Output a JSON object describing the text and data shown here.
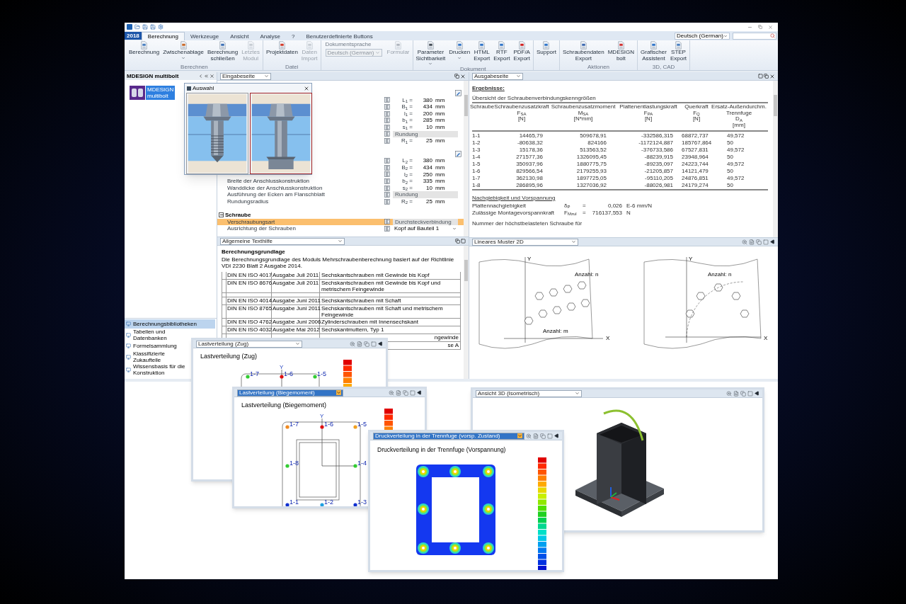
{
  "version": "2018",
  "tabs": [
    {
      "label": "Berechnung",
      "selected": true
    },
    {
      "label": "Werkzeuge",
      "selected": false
    },
    {
      "label": "Ansicht",
      "selected": false
    },
    {
      "label": "Analyse",
      "selected": false
    },
    {
      "label": "?",
      "selected": false
    },
    {
      "label": "Benutzerdefinierte Buttons",
      "selected": false
    }
  ],
  "language": "Deutsch (German)",
  "ribbon": [
    {
      "label": "Berechnen",
      "items": [
        {
          "kind": "button",
          "lines": [
            "Berechnung"
          ],
          "disabled": false,
          "dropdown": false
        },
        {
          "kind": "button",
          "lines": [
            "Zwischenablage"
          ],
          "disabled": false,
          "dropdown": true
        },
        {
          "kind": "button",
          "lines": [
            "Berechnung",
            "schließen"
          ],
          "disabled": false,
          "dropdown": false
        },
        {
          "kind": "button",
          "lines": [
            "Letztes",
            "Modul"
          ],
          "disabled": true,
          "dropdown": false
        }
      ]
    },
    {
      "label": "Datei",
      "items": [
        {
          "kind": "button",
          "lines": [
            "Projektdaten"
          ],
          "disabled": false,
          "dropdown": false
        },
        {
          "kind": "button",
          "lines": [
            "Daten",
            "Import"
          ],
          "disabled": true,
          "dropdown": false
        }
      ]
    },
    {
      "items": [
        {
          "kind": "language",
          "caption": "Dokumentsprache",
          "value": "Deutsch (German)",
          "disabled": true
        },
        {
          "kind": "button",
          "lines": [
            "Formular"
          ],
          "disabled": true,
          "dropdown": false
        }
      ]
    },
    {
      "label": "Dokument",
      "items": [
        {
          "kind": "button",
          "lines": [
            "Parameter",
            "Sichtbarkeit"
          ],
          "disabled": false,
          "dropdown": true
        },
        {
          "kind": "button",
          "lines": [
            "Drucken"
          ],
          "disabled": false,
          "dropdown": true
        },
        {
          "kind": "button",
          "lines": [
            "HTML",
            "Export"
          ],
          "disabled": false,
          "dropdown": false
        },
        {
          "kind": "button",
          "lines": [
            "RTF",
            "Export"
          ],
          "disabled": false,
          "dropdown": false
        },
        {
          "kind": "button",
          "lines": [
            "PDF/A",
            "Export"
          ],
          "disabled": false,
          "dropdown": false
        }
      ]
    },
    {
      "items": [
        {
          "kind": "button",
          "lines": [
            "Support"
          ],
          "disabled": false,
          "dropdown": false
        }
      ]
    },
    {
      "label": "Aktionen",
      "items": [
        {
          "kind": "button",
          "lines": [
            "Schraubendaten",
            "Export"
          ],
          "disabled": false,
          "dropdown": false
        },
        {
          "kind": "button",
          "lines": [
            "MDESIGN",
            "bolt"
          ],
          "disabled": false,
          "dropdown": false
        }
      ]
    },
    {
      "label": "3D, CAD",
      "items": [
        {
          "kind": "button",
          "lines": [
            "Grafischer",
            "Assistent"
          ],
          "disabled": false,
          "dropdown": false
        },
        {
          "kind": "button",
          "lines": [
            "STEP",
            "Export"
          ],
          "disabled": false,
          "dropdown": false
        }
      ]
    }
  ],
  "sidebar": {
    "title": "MDESIGN multibolt",
    "module": [
      "MDESIGN",
      "multibolt"
    ],
    "items": [
      {
        "label": "Berechnungsbibliotheken",
        "selected": true
      },
      {
        "label": "Tabellen und Datenbanken",
        "selected": false
      },
      {
        "label": "Formelsammlung",
        "selected": false
      },
      {
        "label": "Klassifizierte Zukaufteile",
        "selected": false
      },
      {
        "label": "Wissensbasis für die Konstruktion",
        "selected": false
      }
    ]
  },
  "input_page": {
    "view": "Eingabeseite",
    "groups": [
      {
        "rows": [
          {
            "kind": "value",
            "symbol": "L$_{1}$ =",
            "value": "380",
            "unit": "mm",
            "selected": false
          },
          {
            "kind": "value",
            "symbol": "B$_{1}$ =",
            "value": "434",
            "unit": "mm",
            "selected": false
          },
          {
            "kind": "value",
            "symbol": "l$_{1}$ =",
            "value": "200",
            "unit": "mm",
            "selected": false
          },
          {
            "kind": "value",
            "symbol": "b$_{1}$ =",
            "value": "285",
            "unit": "mm",
            "selected": false
          },
          {
            "kind": "value",
            "symbol": "s$_{1}$ =",
            "value": "10",
            "unit": "mm",
            "selected": false
          },
          {
            "kind": "choice",
            "value": "Rundung",
            "selected": false
          },
          {
            "kind": "value",
            "symbol": "R$_{1}$ =",
            "value": "25",
            "unit": "mm",
            "selected": false
          }
        ]
      },
      {
        "rows": [
          {
            "kind": "value",
            "symbol": "L$_{2}$ =",
            "value": "380",
            "unit": "mm",
            "selected": false
          },
          {
            "kind": "value",
            "symbol": "B$_{2}$ =",
            "value": "434",
            "unit": "mm",
            "selected": false
          },
          {
            "kind": "value",
            "symbol": "l$_{2}$ =",
            "value": "250",
            "unit": "mm",
            "selected": false
          },
          {
            "kind": "value",
            "label": "Breite der Anschlusskonstruktion",
            "symbol": "b$_{2}$ =",
            "value": "335",
            "unit": "mm",
            "selected": false
          },
          {
            "kind": "value",
            "label": "Wanddicke der Anschlusskonstruktion",
            "symbol": "s$_{2}$ =",
            "value": "10",
            "unit": "mm",
            "selected": false
          },
          {
            "kind": "choice",
            "label": "Ausführung der Ecken am Flanschblatt",
            "value": "Rundung",
            "selected": false
          },
          {
            "kind": "value",
            "label": "Rundungsradius",
            "symbol": "R$_{2}$ =",
            "value": "25",
            "unit": "mm",
            "selected": false
          }
        ]
      }
    ],
    "screw_section": {
      "title": "Schraube",
      "expanded": true,
      "rows": [
        {
          "kind": "choice",
          "label": "Verschraubungsart",
          "value": "Durchsteckverbindung",
          "selected": true
        },
        {
          "kind": "dropdown",
          "label": "Ausrichtung der Schrauben",
          "value": "Kopf auf Bauteil 1",
          "selected": false
        }
      ]
    }
  },
  "selection_dialog": {
    "title": "Auswahl",
    "options": [
      {
        "kind": "screw",
        "selected": false
      },
      {
        "kind": "through_bolt",
        "selected": true
      }
    ]
  },
  "help_page": {
    "view": "Allgemeine Texthilfe",
    "heading": "Berechnungsgrundlage",
    "intro": "Die Berechnungsgrundlage des Moduls Mehrschraubenberechnung basiert auf der Richtlinie VDI 2230 Blatt 2 Ausgabe 2014.",
    "rows": [
      {
        "kind": "norm",
        "norm": "DIN EN ISO 4017",
        "edition": "Ausgabe Juli 2011",
        "title": "Sechskantschrauben mit Gewinde bis Kopf"
      },
      {
        "kind": "norm",
        "norm": "DIN EN ISO 8676",
        "edition": "Ausgabe Juli 2011",
        "title": "Sechskantschrauben mit Gewinde bis Kopf und metrischem Feingewinde"
      },
      {
        "kind": "blank"
      },
      {
        "kind": "norm",
        "norm": "DIN EN ISO 4014",
        "edition": "Ausgabe Juni 2011",
        "title": "Sechskantschrauben mit Schaft"
      },
      {
        "kind": "norm",
        "norm": "DIN EN ISO 8765",
        "edition": "Ausgabe Juni 2011",
        "title": "Sechskantschrauben mit Schaft und metrischem Feingewinde"
      },
      {
        "kind": "norm",
        "norm": "DIN EN ISO 4762",
        "edition": "Ausgabe Juni 2006",
        "title": "Zylinderschrauben mit Innensechskant"
      },
      {
        "kind": "norm",
        "norm": "DIN EN ISO 4032",
        "edition": "Ausgabe Mai 2012",
        "title": "Sechskantmuttern, Typ 1"
      },
      {
        "kind": "clipped",
        "title": "ngewinde"
      },
      {
        "kind": "clipped",
        "title": "se A"
      }
    ]
  },
  "output_page": {
    "view": "Ausgabeseite",
    "heading": "Ergebnisse:",
    "subtitle": "Übersicht der Schraubenverbindungskenngrößen",
    "columns": [
      {
        "name": "Schraube"
      },
      {
        "name": "Schraubenzusatzkraft",
        "symbol": "F$_{SA}$",
        "unit": "[N]"
      },
      {
        "name": "Schraubenzusatzmoment",
        "symbol": "M$_{SA}$",
        "unit": "[N*mm]"
      },
      {
        "name": "Plattenentlastungskraft",
        "symbol": "F$_{PA}$",
        "unit": "[N]"
      },
      {
        "name": "Querkraft",
        "symbol": "F$_{Q}$",
        "unit": "[N]"
      },
      {
        "name": "Ersatz-Außendurchm. Trennfuge",
        "symbol": "D$_{A}$",
        "unit": "[mm]"
      }
    ],
    "rows": [
      [
        "1-1",
        "14465,79",
        "509678,91",
        "-332586,315",
        "68872,737",
        "49,572"
      ],
      [
        "1-2",
        "-80638,32",
        "824166",
        "-1172124,887",
        "185767,864",
        "50"
      ],
      [
        "1-3",
        "15178,36",
        "513563,52",
        "-376733,586",
        "67527,831",
        "49,572"
      ],
      [
        "1-4",
        "271577,36",
        "1326095,45",
        "-88239,915",
        "23948,964",
        "50"
      ],
      [
        "1-5",
        "350937,96",
        "1880775,75",
        "-89235,097",
        "24223,744",
        "49,572"
      ],
      [
        "1-6",
        "829566,54",
        "2179255,93",
        "-21205,857",
        "14121,479",
        "50"
      ],
      [
        "1-7",
        "362130,98",
        "1897725,05",
        "-95110,205",
        "24876,851",
        "49,572"
      ],
      [
        "1-8",
        "286895,96",
        "1327036,92",
        "-88026,981",
        "24179,274",
        "50"
      ]
    ],
    "section": "Nachgiebigkeit und Vorspannung",
    "quantities": [
      {
        "label": "Plattennachgiebigkeit",
        "symbol": "δ$_{P}$",
        "eq": "=",
        "value": "0,026",
        "unit": "E-6 mm/N"
      },
      {
        "label": "Zulässige Montagevorspannkraft",
        "symbol": "F$_{Mzul}$",
        "eq": "=",
        "value": "716137,553",
        "unit": "N"
      }
    ],
    "footer": "Nummer der höchstbelasteten Schraube für"
  },
  "pattern_view": {
    "view": "Lineares Muster 2D",
    "left": {
      "y_axis": "Y",
      "x_axis": "X",
      "count_n": "Anzahl: n",
      "count_m": "Anzahl: m"
    },
    "right": {
      "y_axis": "Y",
      "x_axis": "X",
      "count_n": "Anzahl: n"
    }
  },
  "windows": [
    {
      "kind": "load",
      "view": "Lastverteilung (Zug)",
      "heading": "Lastverteilung (Zug)",
      "focused": false,
      "axis": "Y",
      "bolts": [
        {
          "label": "1-7",
          "color": "#33cc33"
        },
        {
          "label": "1-6",
          "color": "#e01010"
        },
        {
          "label": "1-5",
          "color": "#33cc33"
        }
      ]
    },
    {
      "kind": "load",
      "view": "Lastverteilung (Biegemoment)",
      "heading": "Lastverteilung (Biegemoment)",
      "focused": true,
      "axis": "Y",
      "bolts": [
        {
          "label": "1-7",
          "color": "#f08a20"
        },
        {
          "label": "1-6",
          "color": "#e01010"
        },
        {
          "label": "1-5",
          "color": "#f0a020"
        },
        {
          "label": "1-8",
          "color": "#33cc33"
        },
        {
          "label": "1-4",
          "color": "#33cc33"
        },
        {
          "label": "1-1",
          "color": "#1030d0"
        },
        {
          "label": "1-2",
          "color": "#20a0e0"
        },
        {
          "label": "1-3",
          "color": "#1030d0"
        }
      ]
    },
    {
      "kind": "pressure",
      "view": "Druckverteilung in der Trennfuge (vorsp. Zustand)",
      "heading": "Druckverteilung in der Trennfuge (Vorspannung)",
      "focused": true
    },
    {
      "kind": "model",
      "view": "Ansicht 3D (Isometrisch)",
      "focused": false
    }
  ]
}
